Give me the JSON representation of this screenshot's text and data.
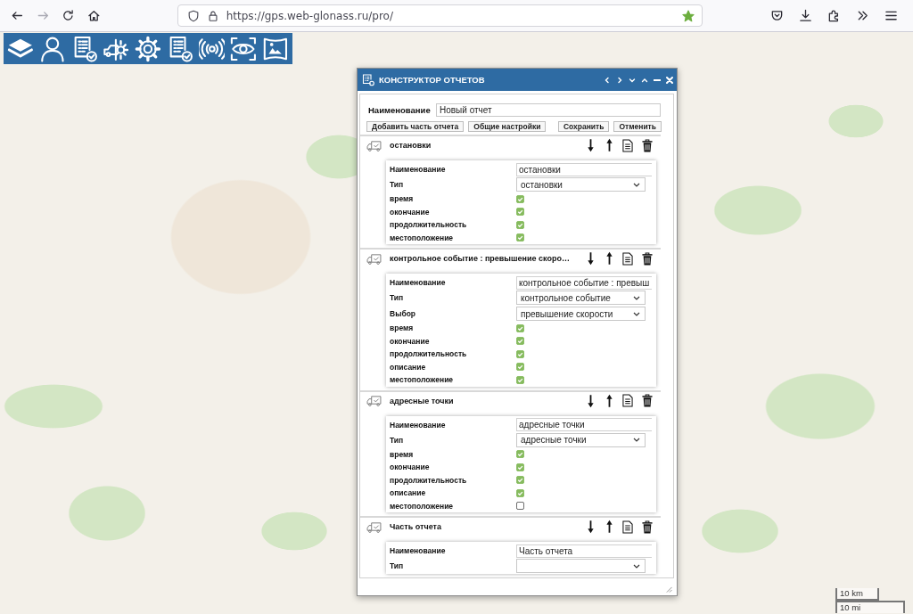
{
  "browser": {
    "url": "https://gps.web-glonass.ru/pro/",
    "forward_disabled": true,
    "bookmarked": true
  },
  "dialog": {
    "title": "КОНСТРУКТОР ОТЧЕТОВ",
    "name_label": "Наименование",
    "name_value": "Новый отчет",
    "buttons_left": [
      "Добавить часть отчета",
      "Общие настройки"
    ],
    "buttons_right": [
      "Сохранить",
      "Отменить"
    ],
    "parts": [
      {
        "title": "остановки",
        "fields": [
          {
            "kind": "text",
            "label": "Наименование",
            "value": "остановки"
          },
          {
            "kind": "select",
            "label": "Тип",
            "value": "остановки"
          },
          {
            "kind": "checkbox",
            "label": "время",
            "checked": true
          },
          {
            "kind": "checkbox",
            "label": "окончание",
            "checked": true
          },
          {
            "kind": "checkbox",
            "label": "продолжительность",
            "checked": true
          },
          {
            "kind": "checkbox",
            "label": "местоположение",
            "checked": true
          }
        ]
      },
      {
        "title": "контрольное событие : превышение скоро…",
        "fields": [
          {
            "kind": "text",
            "label": "Наименование",
            "value": "контрольное событие : превыш"
          },
          {
            "kind": "select",
            "label": "Тип",
            "value": "контрольное событие"
          },
          {
            "kind": "select",
            "label": "Выбор",
            "value": "превышение скорости"
          },
          {
            "kind": "checkbox",
            "label": "время",
            "checked": true
          },
          {
            "kind": "checkbox",
            "label": "окончание",
            "checked": true
          },
          {
            "kind": "checkbox",
            "label": "продолжительность",
            "checked": true
          },
          {
            "kind": "checkbox",
            "label": "описание",
            "checked": true
          },
          {
            "kind": "checkbox",
            "label": "местоположение",
            "checked": true
          }
        ]
      },
      {
        "title": "адресные точки",
        "fields": [
          {
            "kind": "text",
            "label": "Наименование",
            "value": "адресные точки"
          },
          {
            "kind": "select",
            "label": "Тип",
            "value": "адресные точки"
          },
          {
            "kind": "checkbox",
            "label": "время",
            "checked": true
          },
          {
            "kind": "checkbox",
            "label": "окончание",
            "checked": true
          },
          {
            "kind": "checkbox",
            "label": "продолжительность",
            "checked": true
          },
          {
            "kind": "checkbox",
            "label": "описание",
            "checked": true
          },
          {
            "kind": "checkbox",
            "label": "местоположение",
            "checked": false
          }
        ]
      },
      {
        "title": "Часть отчета",
        "fields": [
          {
            "kind": "text",
            "label": "Наименование",
            "value": "Часть отчета"
          },
          {
            "kind": "select",
            "label": "Тип"
          }
        ]
      }
    ]
  },
  "scale": [
    "10 km",
    "10 mi"
  ]
}
